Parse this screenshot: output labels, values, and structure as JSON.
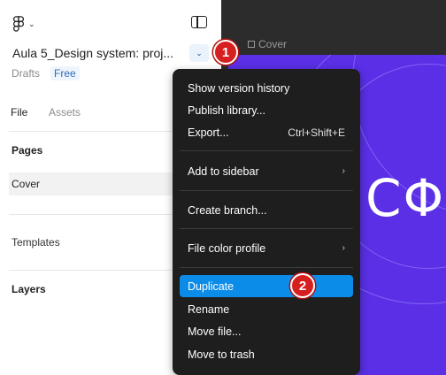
{
  "file": {
    "title": "Aula 5_Design system: proj...",
    "chevron": "⌄",
    "location": "Drafts",
    "plan_badge": "Free"
  },
  "header": {
    "logo_icon": "figma-logo-icon",
    "logo_chevron": "⌄",
    "sidebar_toggle_icon": "sidebar-toggle-icon"
  },
  "tabs": [
    {
      "label": "File",
      "active": true
    },
    {
      "label": "Assets",
      "active": false
    }
  ],
  "pages": {
    "heading": "Pages",
    "items": [
      {
        "label": "Cover",
        "selected": true
      }
    ]
  },
  "templates_label": "Templates",
  "layers_heading": "Layers",
  "canvas": {
    "frame_label": "Cover",
    "frame_text": "CΦ",
    "frame_color": "#5a2fe6"
  },
  "menu": {
    "items": [
      {
        "label": "Show version history",
        "shortcut": "",
        "submenu": false
      },
      {
        "label": "Publish library...",
        "shortcut": "",
        "submenu": false
      },
      {
        "label": "Export...",
        "shortcut": "Ctrl+Shift+E",
        "submenu": false
      },
      {
        "label": "Add to sidebar",
        "shortcut": "",
        "submenu": true
      },
      {
        "label": "Create branch...",
        "shortcut": "",
        "submenu": false
      },
      {
        "label": "File color profile",
        "shortcut": "",
        "submenu": true
      },
      {
        "label": "Duplicate",
        "shortcut": "",
        "submenu": false,
        "highlighted": true
      },
      {
        "label": "Rename",
        "shortcut": "",
        "submenu": false
      },
      {
        "label": "Move file...",
        "shortcut": "",
        "submenu": false
      },
      {
        "label": "Move to trash",
        "shortcut": "",
        "submenu": false
      }
    ],
    "submenu_arrow": "›",
    "highlight_color": "#0c8ce9"
  },
  "steps": [
    {
      "number": "1"
    },
    {
      "number": "2"
    }
  ]
}
